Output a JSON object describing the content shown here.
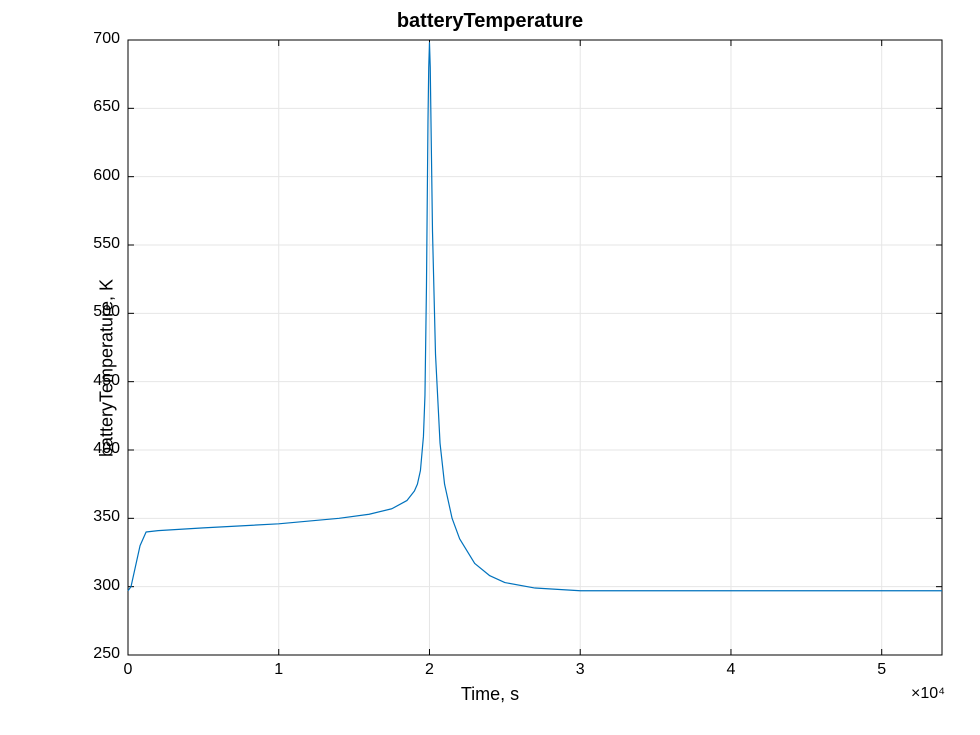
{
  "chart_data": {
    "type": "line",
    "title": "batteryTemperature",
    "xlabel": "Time, s",
    "ylabel": "batteryTemperature, K",
    "xlim": [
      0,
      54000
    ],
    "ylim": [
      250,
      700
    ],
    "x_exponent_label": "×10⁴",
    "x_ticks": [
      0,
      10000,
      20000,
      30000,
      40000,
      50000
    ],
    "x_tick_labels": [
      "0",
      "1",
      "2",
      "3",
      "4",
      "5"
    ],
    "y_ticks": [
      250,
      300,
      350,
      400,
      450,
      500,
      550,
      600,
      650,
      700
    ],
    "y_tick_labels": [
      "250",
      "300",
      "350",
      "400",
      "450",
      "500",
      "550",
      "600",
      "650",
      "700"
    ],
    "line_color": "#0072BD",
    "series": [
      {
        "name": "batteryTemperature",
        "x": [
          0,
          200,
          800,
          1200,
          2000,
          5000,
          10000,
          14000,
          16000,
          17500,
          18500,
          19000,
          19200,
          19400,
          19600,
          19700,
          19800,
          19900,
          19950,
          20000,
          20050,
          20100,
          20200,
          20400,
          20700,
          21000,
          21500,
          22000,
          23000,
          24000,
          25000,
          27000,
          30000,
          35000,
          40000,
          50000,
          54000
        ],
        "y": [
          297,
          300,
          330,
          340,
          341,
          343,
          346,
          350,
          353,
          357,
          363,
          370,
          375,
          385,
          410,
          440,
          520,
          640,
          680,
          698,
          680,
          640,
          560,
          470,
          405,
          375,
          350,
          335,
          317,
          308,
          303,
          299,
          297,
          297,
          297,
          297,
          297
        ]
      }
    ]
  }
}
